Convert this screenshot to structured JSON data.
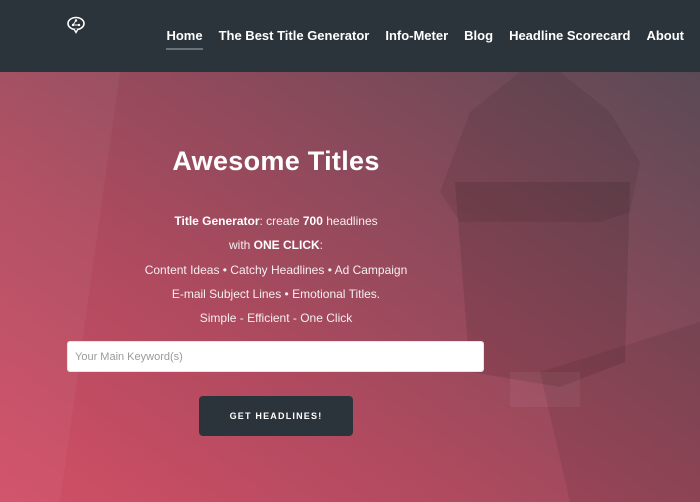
{
  "navbar": {
    "logo_icon": "brain-speech-bubble-icon",
    "items": [
      {
        "label": "Home",
        "active": true
      },
      {
        "label": "The Best Title Generator",
        "active": false
      },
      {
        "label": "Info-Meter",
        "active": false
      },
      {
        "label": "Blog",
        "active": false
      },
      {
        "label": "Headline Scorecard",
        "active": false
      },
      {
        "label": "About",
        "active": false
      }
    ]
  },
  "hero": {
    "title": "Awesome Titles",
    "line1": {
      "bold1": "Title Generator",
      "text1": ": create ",
      "bold2": "700",
      "text2": " headlines"
    },
    "line2": {
      "text1": "with ",
      "bold1": "ONE CLICK",
      "text2": ":"
    },
    "line3": "Content Ideas • Catchy Headlines • Ad Campaign",
    "line4": "E-mail Subject Lines • Emotional Titles.",
    "line5": "Simple - Efficient - One Click",
    "input": {
      "placeholder": "Your Main Keyword(s)",
      "value": ""
    },
    "button_label": "GET HEADLINES!",
    "colors": {
      "gradient_start": "#d24f66",
      "gradient_end": "#5a4a55",
      "nav_bg": "#2b343b"
    }
  }
}
